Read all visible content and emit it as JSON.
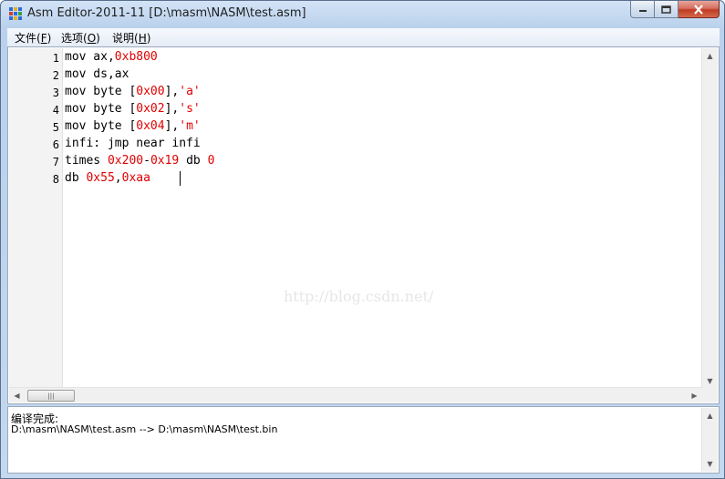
{
  "window": {
    "title": "Asm Editor-2011-11 [D:\\masm\\NASM\\test.asm]"
  },
  "menu": [
    {
      "label": "文件(",
      "key": "F",
      "end": ")"
    },
    {
      "label": "选项(",
      "key": "O",
      "end": ")"
    },
    {
      "label": "说明(",
      "key": "H",
      "end": ")"
    }
  ],
  "editor": {
    "lines": [
      {
        "no": "1",
        "parts": [
          {
            "t": "mov ax,",
            "c": "plain"
          },
          {
            "t": "0xb800",
            "c": "num"
          }
        ]
      },
      {
        "no": "2",
        "parts": [
          {
            "t": "mov ds,ax",
            "c": "plain"
          }
        ]
      },
      {
        "no": "3",
        "parts": [
          {
            "t": "mov byte [",
            "c": "plain"
          },
          {
            "t": "0x00",
            "c": "num"
          },
          {
            "t": "],",
            "c": "plain"
          },
          {
            "t": "'a'",
            "c": "str"
          }
        ]
      },
      {
        "no": "4",
        "parts": [
          {
            "t": "mov byte [",
            "c": "plain"
          },
          {
            "t": "0x02",
            "c": "num"
          },
          {
            "t": "],",
            "c": "plain"
          },
          {
            "t": "'s'",
            "c": "str"
          }
        ]
      },
      {
        "no": "5",
        "parts": [
          {
            "t": "mov byte [",
            "c": "plain"
          },
          {
            "t": "0x04",
            "c": "num"
          },
          {
            "t": "],",
            "c": "plain"
          },
          {
            "t": "'m'",
            "c": "str"
          }
        ]
      },
      {
        "no": "6",
        "parts": [
          {
            "t": "infi: jmp near infi",
            "c": "plain"
          }
        ]
      },
      {
        "no": "7",
        "parts": [
          {
            "t": "times ",
            "c": "plain"
          },
          {
            "t": "0x200",
            "c": "num"
          },
          {
            "t": "-",
            "c": "plain"
          },
          {
            "t": "0x19",
            "c": "num"
          },
          {
            "t": " db ",
            "c": "plain"
          },
          {
            "t": "0",
            "c": "num"
          }
        ]
      },
      {
        "no": "8",
        "parts": [
          {
            "t": "db ",
            "c": "plain"
          },
          {
            "t": "0x55",
            "c": "num"
          },
          {
            "t": ",",
            "c": "plain"
          },
          {
            "t": "0xaa",
            "c": "num"
          }
        ]
      }
    ],
    "watermark": "http://blog.csdn.net/"
  },
  "output": {
    "status": "编译完成:",
    "detail": "D:\\masm\\NASM\\test.asm --> D:\\masm\\NASM\\test.bin"
  },
  "colors": {
    "number": "#e00000",
    "titlebar": "#c4d8ef"
  },
  "icons": {
    "app": "app-grid-icon",
    "minimize": "minimize-icon",
    "maximize": "maximize-icon",
    "close": "close-icon"
  }
}
